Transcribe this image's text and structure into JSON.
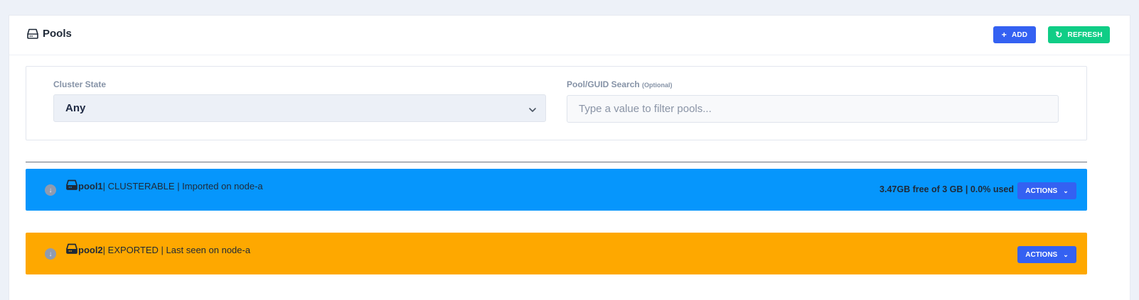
{
  "header": {
    "title": "Pools",
    "title_icon": "hdd-icon",
    "add_label": "ADD",
    "add_icon": "+",
    "refresh_label": "REFRESH",
    "refresh_icon": "↻"
  },
  "filters": {
    "cluster_state_label": "Cluster State",
    "cluster_state_value": "Any",
    "search_label": "Pool/GUID Search",
    "search_optional": "(Optional)",
    "search_placeholder": "Type a value to filter pools...",
    "search_value": ""
  },
  "pools": [
    {
      "name": "pool1",
      "details": " | CLUSTERABLE | Imported on node-a",
      "usage": "3.47GB free of 3 GB | 0.0% used",
      "actions_label": "ACTIONS",
      "color": "#0696fc"
    },
    {
      "name": "pool2",
      "details": " | EXPORTED | Last seen on node-a",
      "usage": "",
      "actions_label": "ACTIONS",
      "color": "#fea800"
    }
  ],
  "colors": {
    "primary": "#3461f2",
    "success": "#10cd86",
    "clusterable": "#0696fc",
    "exported": "#fea800"
  }
}
